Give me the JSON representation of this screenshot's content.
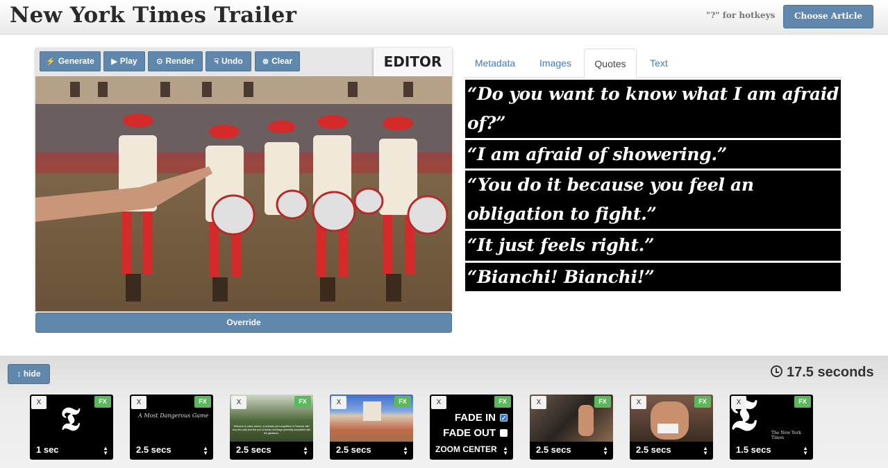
{
  "header": {
    "title": "New York Times Trailer",
    "hotkeys_hint": "\"?\" for hotkeys",
    "choose_article_label": "Choose Article"
  },
  "editor": {
    "label": "EDITOR",
    "toolbar": [
      {
        "label": "Generate",
        "icon": "lightning-icon"
      },
      {
        "label": "Play",
        "icon": "play-icon"
      },
      {
        "label": "Render",
        "icon": "render-icon"
      },
      {
        "label": "Undo",
        "icon": "thumbs-down-icon"
      },
      {
        "label": "Clear",
        "icon": "clear-icon"
      }
    ],
    "override_label": "Override"
  },
  "tabs": [
    {
      "label": "Metadata",
      "active": false
    },
    {
      "label": "Images",
      "active": false
    },
    {
      "label": "Quotes",
      "active": true
    },
    {
      "label": "Text",
      "active": false
    }
  ],
  "quotes": [
    "“Do you want to know what I am afraid of?”",
    "“I am afraid of showering.”",
    "“You do it because you feel an obligation to fight.”",
    "“It just feels right.”",
    "“Bianchi! Bianchi!”"
  ],
  "timeline": {
    "hide_label": "hide",
    "total_duration": "17.5 seconds",
    "clips": [
      {
        "duration": "1 sec",
        "x_label": "X",
        "fx_label": "FX",
        "thumb": "nyt-logo"
      },
      {
        "duration": "2.5 secs",
        "x_label": "X",
        "fx_label": "FX",
        "thumb": "title-card",
        "caption": "A Most Dangerous Game"
      },
      {
        "duration": "2.5 secs",
        "x_label": "X",
        "fx_label": "FX",
        "thumb": "text-card",
        "caption": "Welcome to calcio storico, a centuries-old competition in Florence with very few rules and the sort of human wreckage generally associated with the gladiators."
      },
      {
        "duration": "2.5 secs",
        "x_label": "X",
        "fx_label": "FX",
        "thumb": "piazza"
      },
      {
        "x_label": "X",
        "fx_label": "FX",
        "fade_in_label": "FADE IN",
        "fade_in": true,
        "fade_out_label": "FADE OUT",
        "fade_out": false,
        "zoom_label": "ZOOM CENTER"
      },
      {
        "duration": "2.5 secs",
        "x_label": "X",
        "fx_label": "FX",
        "thumb": "fighters"
      },
      {
        "duration": "2.5 secs",
        "x_label": "X",
        "fx_label": "FX",
        "thumb": "fighter-closeup"
      },
      {
        "duration": "1.5 secs",
        "x_label": "X",
        "fx_label": "FX",
        "thumb": "nyt-end",
        "caption": "The New York Times"
      }
    ]
  },
  "colors": {
    "button_blue": "#6088ad",
    "fx_green": "#5cb85c",
    "link_blue": "#3d7bb8"
  }
}
